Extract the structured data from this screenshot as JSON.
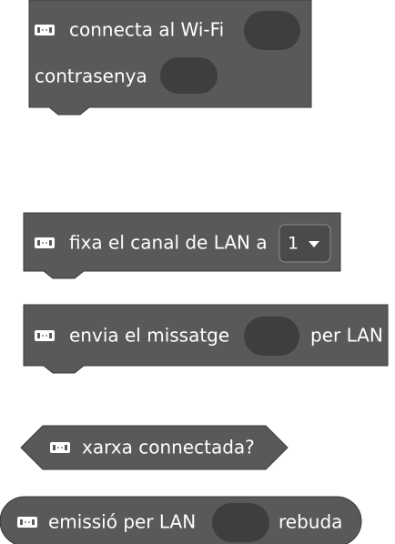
{
  "colors": {
    "block_fill": "#595959",
    "block_stroke": "#3a3a3a",
    "slot_fill": "#3e3e3e",
    "dropdown_fill": "#4a4a4a",
    "dropdown_stroke": "#8c8c8c",
    "icon_fill": "#ffffff",
    "icon_detail": "#595959",
    "text": "#ffffff"
  },
  "blocks": {
    "connect_wifi": {
      "icon": "microbit-board-icon",
      "label": "connecta al Wi-Fi",
      "password_label": "contrasenya"
    },
    "set_channel": {
      "icon": "microbit-board-icon",
      "label": "fixa el canal de LAN a",
      "channel_value": "1",
      "dropdown_icon": "caret-down-icon"
    },
    "send_message": {
      "icon": "microbit-board-icon",
      "label": "envia el missatge",
      "suffix": "per LAN"
    },
    "network_connected": {
      "icon": "microbit-board-icon",
      "label": "xarxa connectada?"
    },
    "lan_broadcast_received": {
      "icon": "microbit-board-icon",
      "label": "emissió per LAN",
      "suffix": "rebuda"
    }
  }
}
